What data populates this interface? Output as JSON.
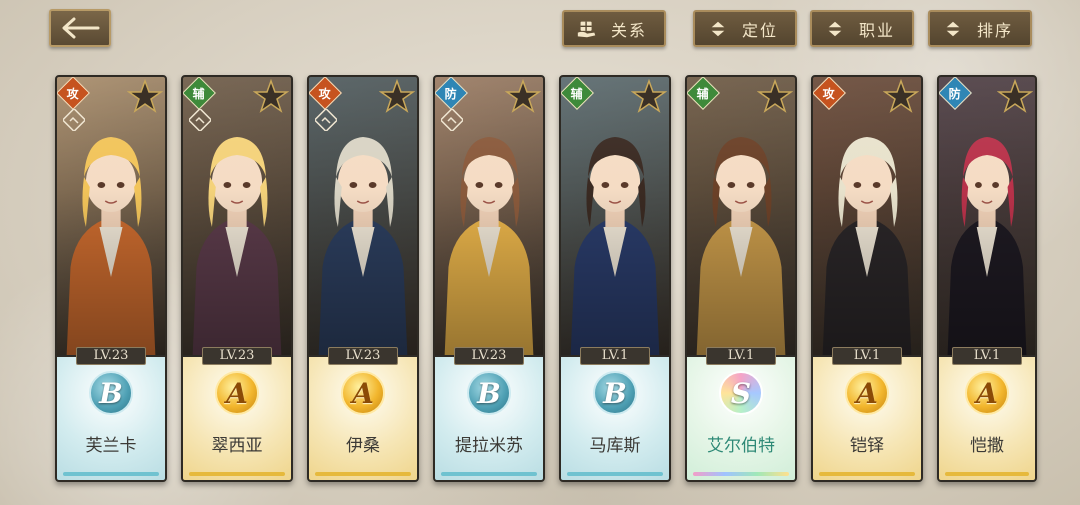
{
  "toolbar": {
    "back_label": "",
    "relation_label": "关系",
    "position_label": "定位",
    "job_label": "职业",
    "sort_label": "排序"
  },
  "colors": {
    "frame_dark": "#2e2a24",
    "button_brown": "#5a4a33",
    "grade_b_tint": "#b9dde3",
    "grade_a_tint": "#efd58c",
    "grade_s_text": "#2f8a77",
    "role_attack": "#c6531f",
    "role_support": "#3e8a3a",
    "role_defense": "#2f86b5"
  },
  "characters": [
    {
      "name": "芙兰卡",
      "level": "LV.23",
      "grade": "B",
      "role": "攻",
      "role_type": "atk",
      "hair": "#f2c45a",
      "outfit": "#c96a2e",
      "bg": "#a88c6a",
      "has_relation": true
    },
    {
      "name": "翠西亚",
      "level": "LV.23",
      "grade": "A",
      "role": "辅",
      "role_type": "sup",
      "hair": "#f4d27a",
      "outfit": "#5b3b4a",
      "bg": "#6f5c48",
      "has_relation": true
    },
    {
      "name": "伊桑",
      "level": "LV.23",
      "grade": "A",
      "role": "攻",
      "role_type": "atk",
      "hair": "#d9d4c4",
      "outfit": "#2c3e5e",
      "bg": "#4f5b5e",
      "has_relation": true
    },
    {
      "name": "提拉米苏",
      "level": "LV.23",
      "grade": "B",
      "role": "防",
      "role_type": "def",
      "hair": "#8a5a3c",
      "outfit": "#e8b34a",
      "bg": "#9a7b62",
      "has_relation": true
    },
    {
      "name": "马库斯",
      "level": "LV.1",
      "grade": "B",
      "role": "辅",
      "role_type": "sup",
      "hair": "#3a2a22",
      "outfit": "#2a3c6a",
      "bg": "#5a6a6e",
      "has_relation": false
    },
    {
      "name": "艾尔伯特",
      "level": "LV.1",
      "grade": "S",
      "role": "辅",
      "role_type": "sup",
      "hair": "#6b4128",
      "outfit": "#c89a4a",
      "bg": "#6e5a44",
      "has_relation": false
    },
    {
      "name": "铠铎",
      "level": "LV.1",
      "grade": "A",
      "role": "攻",
      "role_type": "atk",
      "hair": "#e8e2cc",
      "outfit": "#2a2628",
      "bg": "#6a4a38",
      "has_relation": false
    },
    {
      "name": "恺撒",
      "level": "LV.1",
      "grade": "A",
      "role": "防",
      "role_type": "def",
      "hair": "#b8324a",
      "outfit": "#1e1a22",
      "bg": "#4e3e44",
      "has_relation": false
    }
  ]
}
